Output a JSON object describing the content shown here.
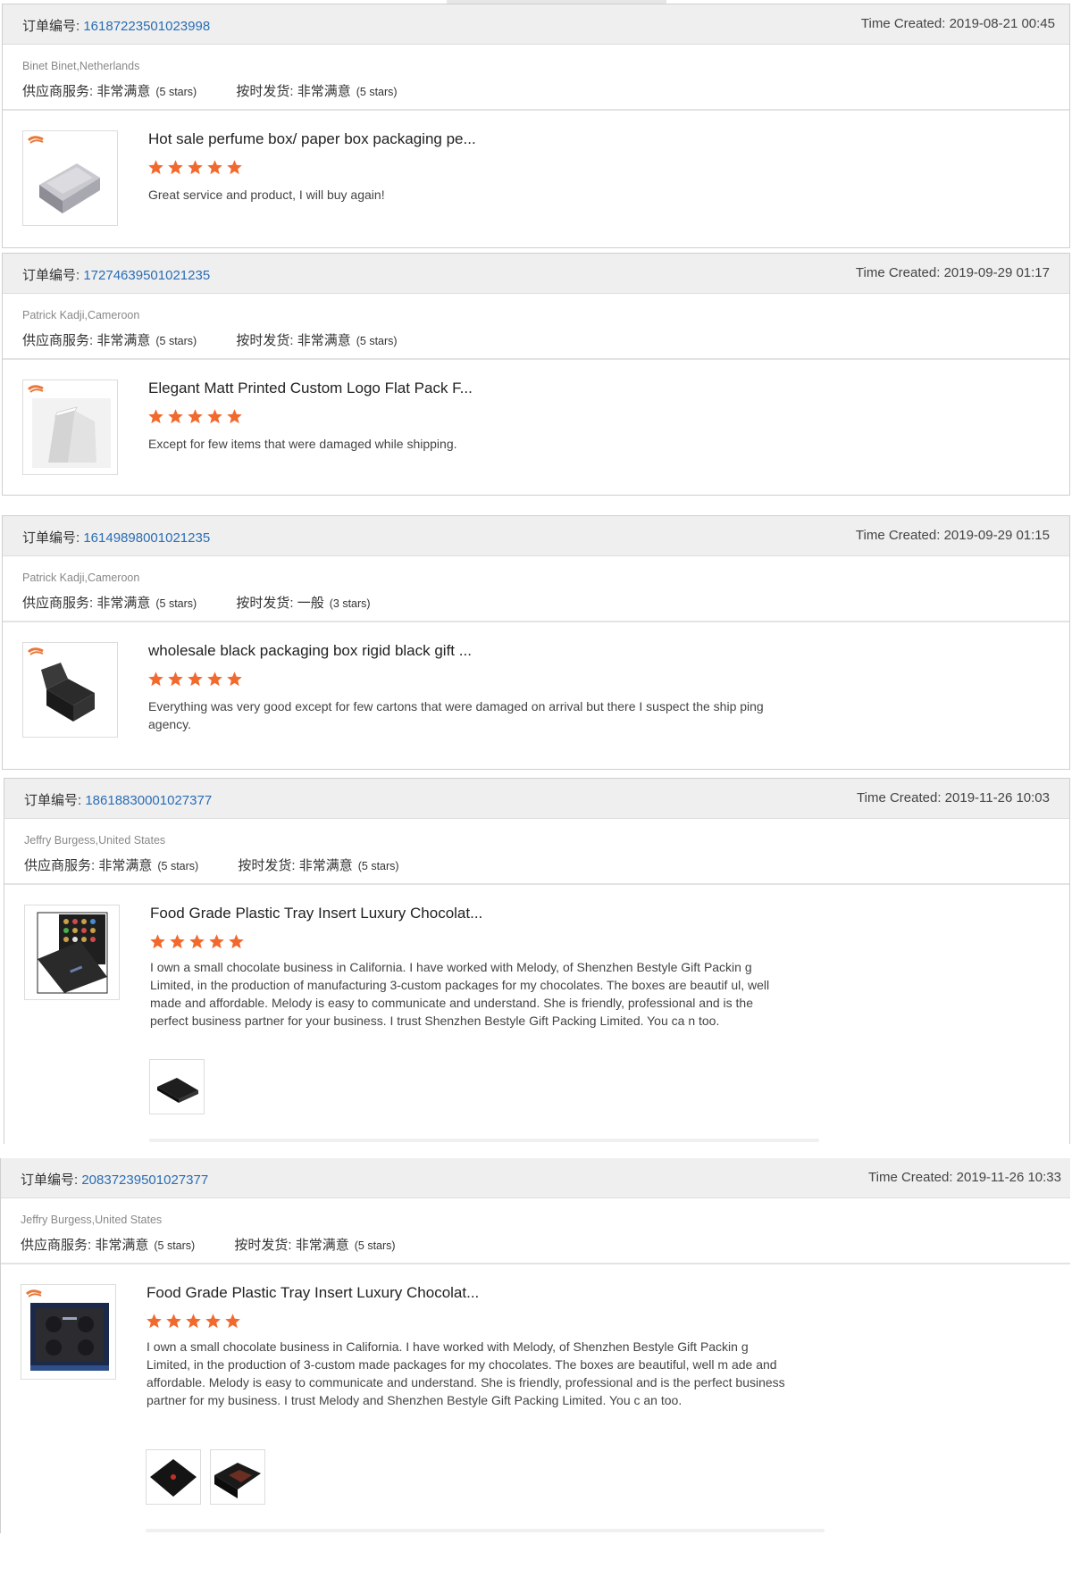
{
  "labels": {
    "order_label": "订单编号:",
    "time_label": "Time Created:",
    "supplier_label": "供应商服务:",
    "ontime_label": "按时发货:"
  },
  "colors": {
    "star": "#f2692e",
    "order_link": "#2a6db4",
    "header_bg": "#efefef"
  },
  "orders": [
    {
      "order_no": "16187223501023998",
      "time": "2019-08-21 00:45",
      "buyer": "Binet Binet,Netherlands",
      "supplier_value": "非常满意",
      "supplier_stars": "(5 stars)",
      "ontime_value": "非常满意",
      "ontime_stars": "(5 stars)",
      "product_title": "Hot sale perfume box/ paper box packaging pe...",
      "rating": 5,
      "review": "Great service and product, I will buy again!",
      "thumb_icon": "grey-perfume-box-image"
    },
    {
      "order_no": "17274639501021235",
      "time": "2019-09-29 01:17",
      "buyer": "Patrick Kadji,Cameroon",
      "supplier_value": "非常满意",
      "supplier_stars": "(5 stars)",
      "ontime_value": "非常满意",
      "ontime_stars": "(5 stars)",
      "product_title": "Elegant Matt Printed Custom Logo Flat Pack F...",
      "rating": 5,
      "review": "Except for few items that were damaged while shipping.",
      "thumb_icon": "white-flat-pack-box-image"
    },
    {
      "order_no": "16149898001021235",
      "time": "2019-09-29 01:15",
      "buyer": "Patrick Kadji,Cameroon",
      "supplier_value": "非常满意",
      "supplier_stars": "(5 stars)",
      "ontime_value": "一般",
      "ontime_stars": "(3 stars)",
      "product_title": "wholesale black packaging box rigid black gift ...",
      "rating": 5,
      "review": "Everything was very good except for few cartons that were damaged on arrival but there I suspect the ship ping agency.",
      "thumb_icon": "black-gift-box-image"
    },
    {
      "order_no": "18618830001027377",
      "time": "2019-11-26 10:03",
      "buyer": "Jeffry Burgess,United States",
      "supplier_value": "非常满意",
      "supplier_stars": "(5 stars)",
      "ontime_value": "非常满意",
      "ontime_stars": "(5 stars)",
      "product_title": "Food Grade Plastic Tray Insert Luxury Chocolat...",
      "rating": 5,
      "review": "I own a small chocolate business in California. I have worked with Melody, of Shenzhen Bestyle Gift Packin g Limited, in the production of manufacturing 3-custom packages for my chocolates. The boxes are beautif ul, well made and affordable. Melody is easy to communicate and understand. She is friendly, professional and is the perfect business partner for your business. I trust Shenzhen Bestyle Gift Packing Limited. You ca n too.",
      "thumb_icon": "chocolate-tray-box-image",
      "attachments": [
        "black-slim-box-photo"
      ]
    },
    {
      "order_no": "20837239501027377",
      "time": "2019-11-26 10:33",
      "buyer": "Jeffry Burgess,United States",
      "supplier_value": "非常满意",
      "supplier_stars": "(5 stars)",
      "ontime_value": "非常满意",
      "ontime_stars": "(5 stars)",
      "product_title": "Food Grade Plastic Tray Insert Luxury Chocolat...",
      "rating": 5,
      "review": "I own a small chocolate business in California. I have worked with Melody, of Shenzhen Bestyle Gift Packin g Limited, in the production of 3-custom made packages for my chocolates. The boxes are beautiful, well m ade and affordable. Melody is easy to communicate and understand. She is friendly, professional and is the perfect business partner for my business. I trust Melody and Shenzhen Bestyle Gift Packing Limited. You c an too.",
      "thumb_icon": "blue-chocolate-box-image",
      "attachments": [
        "black-box-red-logo-photo",
        "open-chocolate-box-photo"
      ]
    }
  ]
}
